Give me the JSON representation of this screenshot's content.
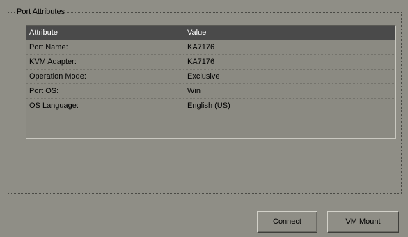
{
  "group": {
    "title": "Port Attributes"
  },
  "table": {
    "headers": {
      "attribute": "Attribute",
      "value": "Value"
    },
    "rows": [
      {
        "attribute": "Port Name:",
        "value": "KA7176"
      },
      {
        "attribute": "KVM Adapter:",
        "value": "KA7176"
      },
      {
        "attribute": "Operation Mode:",
        "value": "Exclusive"
      },
      {
        "attribute": "Port OS:",
        "value": "Win"
      },
      {
        "attribute": "OS Language:",
        "value": "English (US)"
      }
    ]
  },
  "buttons": {
    "connect_label": "Connect",
    "vm_mount_label": "VM Mount"
  }
}
